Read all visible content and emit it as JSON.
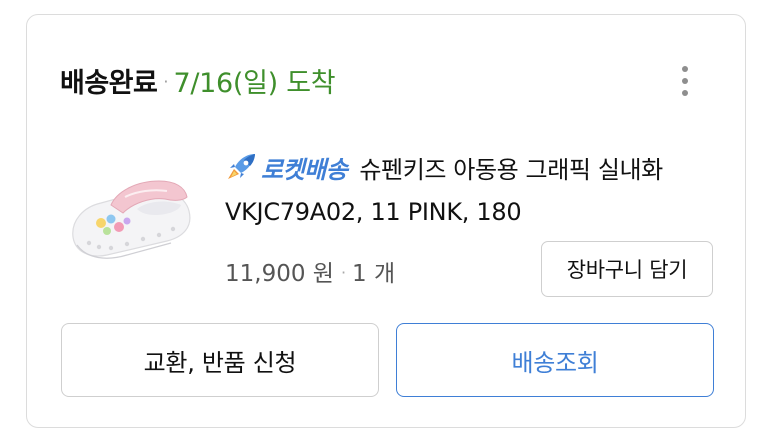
{
  "order": {
    "status": "배송완료",
    "separator": "·",
    "arrival": "7/16(일) 도착"
  },
  "menu": {
    "icon": "more-vertical-icon"
  },
  "product": {
    "thumbnail_icon": "kids-shoe-thumbnail",
    "delivery_badge": "로켓배송",
    "delivery_badge_icon": "rocket-icon",
    "name": "슈펜키즈 아동용 그래픽 실내화",
    "option": "VKJC79A02, 11 PINK, 180",
    "price": "11,900 원",
    "price_separator": "·",
    "quantity": "1 개"
  },
  "actions": {
    "add_to_cart": "장바구니 담기",
    "exchange_return": "교환, 반품 신청",
    "track_delivery": "배송조회"
  },
  "colors": {
    "status_green": "#3f8f2c",
    "rocket_blue": "#3f7fd6",
    "border_gray": "#cfcfcf"
  }
}
